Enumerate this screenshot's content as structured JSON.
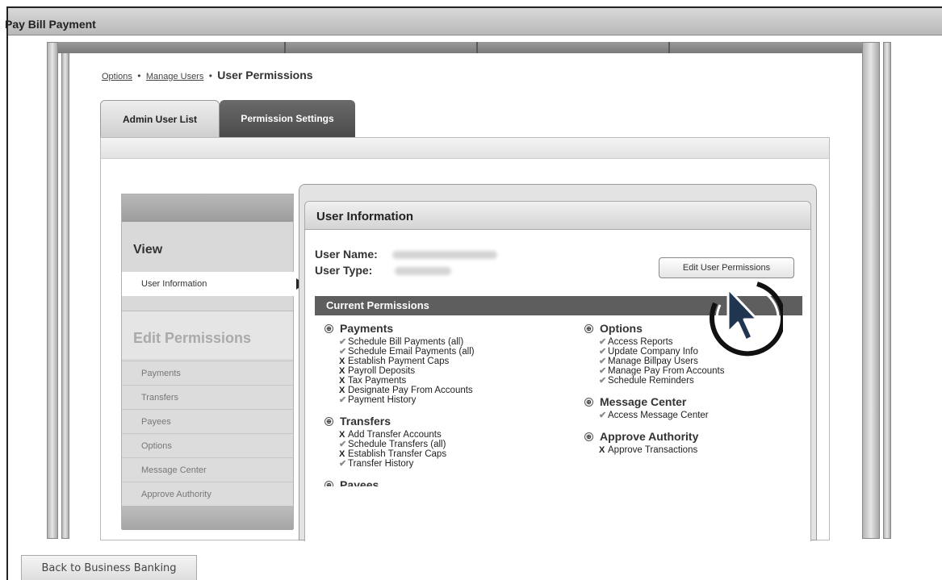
{
  "window": {
    "title": "Pay Bill Payment"
  },
  "breadcrumb": {
    "items": [
      "Options",
      "Manage Users"
    ],
    "separator": "•",
    "current": "User Permissions"
  },
  "tabs": [
    {
      "label": "Admin User List",
      "active": false
    },
    {
      "label": "Permission Settings",
      "active": true
    }
  ],
  "view_nav": {
    "title": "View",
    "active_item": "User Information",
    "edit_title": "Edit Permissions",
    "edit_items": [
      "Payments",
      "Transfers",
      "Payees",
      "Options",
      "Message Center",
      "Approve Authority"
    ]
  },
  "user_info": {
    "title": "User Information",
    "name_label": "User Name:",
    "type_label": "User Type:",
    "edit_button": "Edit User Permissions"
  },
  "permissions": {
    "header": "Current Permissions",
    "left_groups": [
      {
        "title": "Payments",
        "items": [
          {
            "label": "Schedule Bill Payments (all)",
            "granted": true
          },
          {
            "label": "Schedule Email Payments (all)",
            "granted": true
          },
          {
            "label": "Establish Payment Caps",
            "granted": false
          },
          {
            "label": "Payroll Deposits",
            "granted": false
          },
          {
            "label": "Tax Payments",
            "granted": false
          },
          {
            "label": "Designate Pay From Accounts",
            "granted": false
          },
          {
            "label": "Payment History",
            "granted": true
          }
        ]
      },
      {
        "title": "Transfers",
        "items": [
          {
            "label": "Add Transfer Accounts",
            "granted": false
          },
          {
            "label": "Schedule Transfers (all)",
            "granted": true
          },
          {
            "label": "Establish Transfer Caps",
            "granted": false
          },
          {
            "label": "Transfer History",
            "granted": true
          }
        ]
      },
      {
        "title": "Payees",
        "items": []
      }
    ],
    "right_groups": [
      {
        "title": "Options",
        "items": [
          {
            "label": "Access Reports",
            "granted": true
          },
          {
            "label": "Update Company Info",
            "granted": true
          },
          {
            "label": "Manage Billpay Users",
            "granted": true
          },
          {
            "label": "Manage Pay From Accounts",
            "granted": true
          },
          {
            "label": "Schedule Reminders",
            "granted": true
          }
        ]
      },
      {
        "title": "Message Center",
        "items": [
          {
            "label": "Access Message Center",
            "granted": true
          }
        ]
      },
      {
        "title": "Approve Authority",
        "items": [
          {
            "label": "Approve Transactions",
            "granted": false
          }
        ]
      }
    ],
    "granted_mark": "✔",
    "denied_mark": "X",
    "group_icon": "⊕"
  },
  "footer": {
    "back_button": "Back to Business Banking"
  },
  "icons": {
    "cursor": "mouse-pointer-icon",
    "arrow": "triangle-right-icon"
  },
  "colors": {
    "header_dark": "#5e5e5e",
    "tab_active": "#4a4a4a"
  }
}
